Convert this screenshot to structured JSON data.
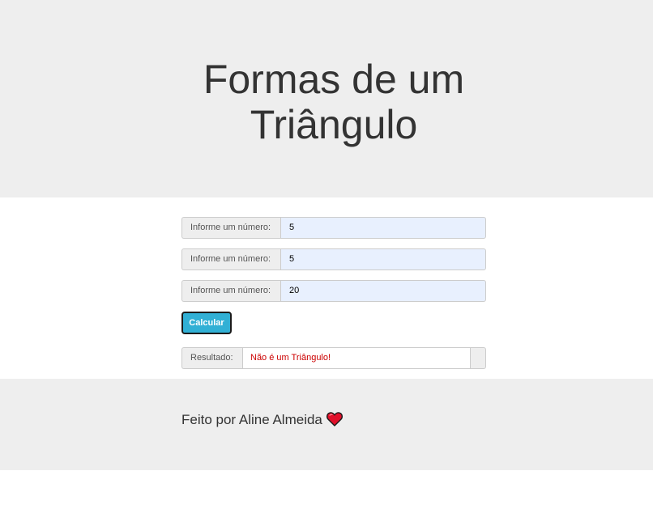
{
  "header": {
    "title_line1": "Formas de um",
    "title_line2": "Triângulo"
  },
  "form": {
    "fields": [
      {
        "label": "Informe um número:",
        "value": "5"
      },
      {
        "label": "Informe um número:",
        "value": "5"
      },
      {
        "label": "Informe um número:",
        "value": "20"
      }
    ],
    "calculate_label": "Calcular",
    "result_label": "Resultado:",
    "result_value": "Não é um Triângulo!"
  },
  "footer": {
    "text": "Feito por Aline Almeida",
    "icon": "heart-icon"
  },
  "colors": {
    "header_bg": "#eeeeee",
    "button_bg": "#31b0d5",
    "result_text": "#cc0000",
    "heart": "#e0102a"
  }
}
